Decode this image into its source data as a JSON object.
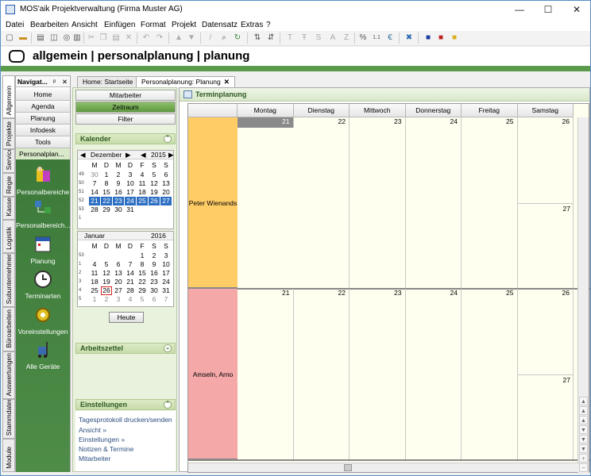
{
  "window": {
    "title": "MOS'aik Projektverwaltung (Firma Muster AG)",
    "controls": [
      "—",
      "☐",
      "✕"
    ]
  },
  "menu": [
    "Datei",
    "Bearbeiten",
    "Ansicht",
    "Einfügen",
    "Format",
    "Projekt",
    "Datensatz",
    "Extras",
    "?"
  ],
  "header": {
    "title": "allgemein | personalplanung | planung"
  },
  "vtabs": [
    "Allgemein",
    "Projekte",
    "Service",
    "Regie",
    "Kasse",
    "Logistik",
    "Subunternehmer",
    "Büroarbeiten",
    "Auswertungen",
    "Stammdaten",
    "Module"
  ],
  "nav": {
    "title": "Navigat...",
    "pin": "ᵖ",
    "close": "✕",
    "buttons": [
      "Home",
      "Agenda",
      "Planung",
      "Infodesk",
      "Tools",
      "Personalplan..."
    ],
    "items": [
      {
        "label": "Personalbereiche",
        "icon": "personnel-areas-icon"
      },
      {
        "label": "Personalbereich...",
        "icon": "personnel-area-edit-icon"
      },
      {
        "label": "Planung",
        "icon": "planning-calendar-icon"
      },
      {
        "label": "Terminarten",
        "icon": "clock-icon"
      },
      {
        "label": "Voreinstellungen",
        "icon": "settings-gear-icon"
      },
      {
        "label": "Alle Geräte",
        "icon": "forklift-icon"
      }
    ]
  },
  "doctabs": [
    {
      "label": "Home: Startseite",
      "active": false
    },
    {
      "label": "Personalplanung: Planung",
      "active": true
    }
  ],
  "left": {
    "segments": [
      "Mitarbeiter",
      "Zeitraum",
      "Filter"
    ],
    "kalender": "Kalender",
    "cal1": {
      "month": "Dezember",
      "year": "2015",
      "days": [
        "M",
        "D",
        "M",
        "D",
        "F",
        "S",
        "S"
      ],
      "rows": [
        {
          "wk": "49",
          "d": [
            "30",
            "1",
            "2",
            "3",
            "4",
            "5",
            "6"
          ]
        },
        {
          "wk": "50",
          "d": [
            "7",
            "8",
            "9",
            "10",
            "11",
            "12",
            "13"
          ]
        },
        {
          "wk": "51",
          "d": [
            "14",
            "15",
            "16",
            "17",
            "18",
            "19",
            "20"
          ]
        },
        {
          "wk": "52",
          "d": [
            "21",
            "22",
            "23",
            "24",
            "25",
            "26",
            "27"
          ]
        },
        {
          "wk": "53",
          "d": [
            "28",
            "29",
            "30",
            "31",
            "",
            "",
            ""
          ]
        },
        {
          "wk": "1",
          "d": [
            "",
            "",
            "",
            "",
            "",
            "",
            ""
          ]
        }
      ]
    },
    "cal2": {
      "month": "Januar",
      "year": "2016",
      "days": [
        "M",
        "D",
        "M",
        "D",
        "F",
        "S",
        "S"
      ],
      "rows": [
        {
          "wk": "53",
          "d": [
            "",
            "",
            "",
            "",
            "1",
            "2",
            "3"
          ]
        },
        {
          "wk": "1",
          "d": [
            "4",
            "5",
            "6",
            "7",
            "8",
            "9",
            "10"
          ]
        },
        {
          "wk": "2",
          "d": [
            "11",
            "12",
            "13",
            "14",
            "15",
            "16",
            "17"
          ]
        },
        {
          "wk": "3",
          "d": [
            "18",
            "19",
            "20",
            "21",
            "22",
            "23",
            "24"
          ]
        },
        {
          "wk": "4",
          "d": [
            "25",
            "26",
            "27",
            "28",
            "29",
            "30",
            "31"
          ]
        },
        {
          "wk": "5",
          "d": [
            "1",
            "2",
            "3",
            "4",
            "5",
            "6",
            "7"
          ]
        }
      ]
    },
    "heute": "Heute",
    "arbeitszettel": "Arbeitszettel",
    "einstellungen": "Einstellungen",
    "links": [
      "Tagesprotokoll drucken/senden",
      "Ansicht »",
      "Einstellungen »",
      "Notizen & Termine",
      "Mitarbeiter"
    ]
  },
  "main": {
    "title": "Terminplanung",
    "days": [
      "Montag",
      "Dienstag",
      "Mittwoch",
      "Donnerstag",
      "Freitag",
      "Samstag"
    ],
    "persons": [
      {
        "name": "Peter Wienands",
        "color": "#ffcc66",
        "dates": [
          "21",
          "22",
          "23",
          "24",
          "25",
          "26"
        ],
        "sunday": "27"
      },
      {
        "name": "Amseln, Arno",
        "color": "#f4a8a8",
        "dates": [
          "21",
          "22",
          "23",
          "24",
          "25",
          "26"
        ],
        "sunday": "27"
      }
    ]
  }
}
